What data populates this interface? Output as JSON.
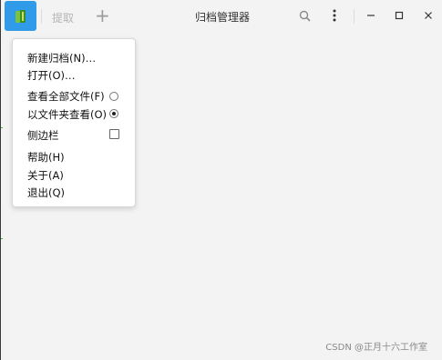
{
  "titlebar": {
    "extract_label": "提取",
    "add_label": "+",
    "title": "归档管理器"
  },
  "menu": {
    "items": [
      {
        "label": "新建归档(N)…"
      },
      {
        "label": "打开(O)…"
      },
      {
        "label": "查看全部文件(F)",
        "control": "radio",
        "checked": false
      },
      {
        "label": "以文件夹查看(O)",
        "control": "radio",
        "checked": true
      },
      {
        "label": "侧边栏",
        "control": "checkbox",
        "checked": false
      },
      {
        "label": "帮助(H)"
      },
      {
        "label": "关于(A)"
      },
      {
        "label": "退出(Q)"
      }
    ]
  },
  "watermark": "CSDN @正月十六工作室",
  "colors": {
    "accent": "#2f9be9",
    "background": "#f3f3f3"
  },
  "icons": {
    "app": "archive-manager-icon",
    "search": "search-icon",
    "more": "kebab-menu-icon",
    "minimize": "minimize-icon",
    "maximize": "maximize-icon",
    "close": "close-icon"
  }
}
